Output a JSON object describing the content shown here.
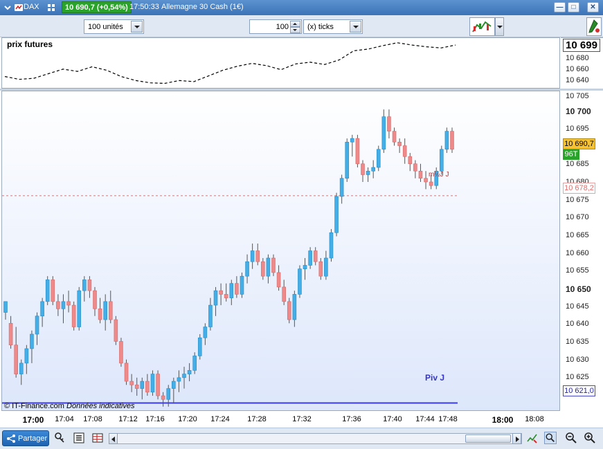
{
  "titlebar": {
    "symbol": "DAX",
    "price_change": "10 690,7 (+0,54%)",
    "time": "17:50:33",
    "instrument": "Allemagne 30 Cash (1€)"
  },
  "toolbar": {
    "units_select": "100 unités",
    "ticks_value": "100",
    "ticks_select": "(x) ticks"
  },
  "top_pane": {
    "title": "prix futures",
    "last_value": "10 699",
    "y_labels": [
      "10 680",
      "10 660",
      "10 640"
    ]
  },
  "main_pane": {
    "y_labels": [
      {
        "text": "10 705",
        "bold": false
      },
      {
        "text": "10 700",
        "bold": true
      },
      {
        "text": "10 695",
        "bold": false
      },
      {
        "text": "10 685",
        "bold": false
      },
      {
        "text": "10 680",
        "bold": false
      },
      {
        "text": "10 675",
        "bold": false
      },
      {
        "text": "10 670",
        "bold": false
      },
      {
        "text": "10 665",
        "bold": false
      },
      {
        "text": "10 660",
        "bold": false
      },
      {
        "text": "10 655",
        "bold": false
      },
      {
        "text": "10 650",
        "bold": true
      },
      {
        "text": "10 645",
        "bold": false
      },
      {
        "text": "10 640",
        "bold": false
      },
      {
        "text": "10 635",
        "bold": false
      },
      {
        "text": "10 630",
        "bold": false
      },
      {
        "text": "10 625",
        "bold": false
      }
    ],
    "current_price": "10 690,7",
    "tick_count": "96T",
    "reference_price": "10 678,2",
    "pivot_price": "10 621,0",
    "pivot_label": "Piv J",
    "marker_label": "m½J J",
    "copyright": "© IT-Finance.com",
    "disclaimer": "Données indicatives"
  },
  "x_axis": [
    {
      "text": "17:00",
      "bold": true
    },
    {
      "text": "17:04",
      "bold": false
    },
    {
      "text": "17:08",
      "bold": false
    },
    {
      "text": "17:12",
      "bold": false
    },
    {
      "text": "17:16",
      "bold": false
    },
    {
      "text": "17:20",
      "bold": false
    },
    {
      "text": "17:24",
      "bold": false
    },
    {
      "text": "17:28",
      "bold": false
    },
    {
      "text": "17:32",
      "bold": false
    },
    {
      "text": "17:36",
      "bold": false
    },
    {
      "text": "17:40",
      "bold": false
    },
    {
      "text": "17:44",
      "bold": false
    },
    {
      "text": "17:48",
      "bold": false
    },
    {
      "text": "18:00",
      "bold": true
    },
    {
      "text": "18:08",
      "bold": false
    }
  ],
  "bottombar": {
    "share_label": "Partager"
  },
  "colors": {
    "bull": "#44aee6",
    "bear": "#ee8a8a",
    "pivot": "#3c3cd4",
    "reference": "#e07070",
    "price_badge": "#2aa32a",
    "current_price_box": "#f6c232"
  },
  "chart_data": [
    {
      "type": "line",
      "title": "prix futures",
      "ylim": [
        10630,
        10705
      ],
      "series": [
        {
          "values": [
            10645,
            10640,
            10642,
            10650,
            10658,
            10654,
            10662,
            10656,
            10645,
            10638,
            10634,
            10633,
            10638,
            10636,
            10646,
            10656,
            10663,
            10668,
            10664,
            10657,
            10667,
            10670,
            10666,
            10674,
            10690,
            10693,
            10699,
            10704,
            10700,
            10697,
            10695,
            10700
          ]
        }
      ]
    },
    {
      "type": "candlestick",
      "ylim": [
        10619,
        10707
      ],
      "reference_lines": [
        {
          "label": "Piv J",
          "value": 10621.0
        },
        {
          "value": 10678.2
        }
      ],
      "candles": [
        [
          10646,
          10649,
          10644,
          10649
        ],
        [
          10643,
          10645,
          10636,
          10637
        ],
        [
          10637,
          10642,
          10628,
          10629
        ],
        [
          10629,
          10633,
          10626,
          10632
        ],
        [
          10632,
          10637,
          10629,
          10636
        ],
        [
          10636,
          10641,
          10632,
          10640
        ],
        [
          10640,
          10646,
          10637,
          10645
        ],
        [
          10645,
          10650,
          10642,
          10649
        ],
        [
          10649,
          10656,
          10648,
          10655
        ],
        [
          10655,
          10656,
          10648,
          10649
        ],
        [
          10649,
          10651,
          10645,
          10647
        ],
        [
          10647,
          10651,
          10643,
          10649
        ],
        [
          10649,
          10652,
          10646,
          10648
        ],
        [
          10648,
          10649,
          10641,
          10642
        ],
        [
          10642,
          10653,
          10641,
          10652
        ],
        [
          10652,
          10656,
          10649,
          10655
        ],
        [
          10655,
          10656,
          10650,
          10652
        ],
        [
          10652,
          10653,
          10645,
          10647
        ],
        [
          10647,
          10650,
          10643,
          10644
        ],
        [
          10644,
          10651,
          10641,
          10649
        ],
        [
          10649,
          10652,
          10643,
          10644
        ],
        [
          10644,
          10645,
          10637,
          10638
        ],
        [
          10638,
          10639,
          10631,
          10632
        ],
        [
          10632,
          10633,
          10626,
          10627
        ],
        [
          10627,
          10629,
          10624,
          10626
        ],
        [
          10626,
          10628,
          10623,
          10625
        ],
        [
          10625,
          10628,
          10622,
          10627
        ],
        [
          10627,
          10629,
          10623,
          10624
        ],
        [
          10624,
          10630,
          10623,
          10629
        ],
        [
          10629,
          10630,
          10622,
          10623
        ],
        [
          10623,
          10624,
          10620,
          10622
        ],
        [
          10622,
          10626,
          10620,
          10625
        ],
        [
          10625,
          10628,
          10621,
          10627
        ],
        [
          10627,
          10630,
          10624,
          10628
        ],
        [
          10628,
          10631,
          10625,
          10629
        ],
        [
          10629,
          10632,
          10627,
          10630
        ],
        [
          10630,
          10635,
          10629,
          10634
        ],
        [
          10634,
          10640,
          10633,
          10639
        ],
        [
          10639,
          10643,
          10637,
          10642
        ],
        [
          10642,
          10650,
          10641,
          10648
        ],
        [
          10648,
          10653,
          10645,
          10652
        ],
        [
          10652,
          10654,
          10648,
          10651
        ],
        [
          10651,
          10654,
          10649,
          10650
        ],
        [
          10650,
          10655,
          10648,
          10654
        ],
        [
          10654,
          10656,
          10650,
          10651
        ],
        [
          10651,
          10657,
          10650,
          10656
        ],
        [
          10656,
          10662,
          10654,
          10660
        ],
        [
          10660,
          10665,
          10658,
          10663
        ],
        [
          10663,
          10665,
          10659,
          10660
        ],
        [
          10660,
          10661,
          10655,
          10656
        ],
        [
          10656,
          10662,
          10654,
          10661
        ],
        [
          10661,
          10662,
          10656,
          10657
        ],
        [
          10657,
          10659,
          10652,
          10653
        ],
        [
          10653,
          10655,
          10648,
          10649
        ],
        [
          10649,
          10650,
          10643,
          10644
        ],
        [
          10644,
          10652,
          10642,
          10651
        ],
        [
          10651,
          10659,
          10650,
          10658
        ],
        [
          10658,
          10661,
          10655,
          10659
        ],
        [
          10659,
          10664,
          10658,
          10663
        ],
        [
          10663,
          10664,
          10659,
          10660
        ],
        [
          10660,
          10661,
          10655,
          10656
        ],
        [
          10656,
          10663,
          10655,
          10661
        ],
        [
          10661,
          10669,
          10660,
          10668
        ],
        [
          10668,
          10679,
          10667,
          10678
        ],
        [
          10678,
          10684,
          10676,
          10683
        ],
        [
          10683,
          10694,
          10682,
          10693
        ],
        [
          10693,
          10695,
          10689,
          10694
        ],
        [
          10694,
          10695,
          10686,
          10687
        ],
        [
          10687,
          10688,
          10682,
          10684
        ],
        [
          10684,
          10686,
          10682,
          10685
        ],
        [
          10685,
          10688,
          10683,
          10686
        ],
        [
          10686,
          10692,
          10685,
          10691
        ],
        [
          10691,
          10702,
          10690,
          10700
        ],
        [
          10700,
          10702,
          10694,
          10696
        ],
        [
          10696,
          10697,
          10692,
          10693
        ],
        [
          10693,
          10694,
          10690,
          10692
        ],
        [
          10692,
          10694,
          10687,
          10689
        ],
        [
          10689,
          10690,
          10685,
          10687
        ],
        [
          10687,
          10688,
          10683,
          10685
        ],
        [
          10685,
          10687,
          10682,
          10683
        ],
        [
          10683,
          10685,
          10680,
          10682
        ],
        [
          10682,
          10684,
          10680,
          10681
        ],
        [
          10681,
          10686,
          10680,
          10685
        ],
        [
          10685,
          10692,
          10684,
          10691
        ],
        [
          10691,
          10697,
          10690,
          10696
        ],
        [
          10696,
          10697,
          10690,
          10691
        ]
      ]
    }
  ]
}
